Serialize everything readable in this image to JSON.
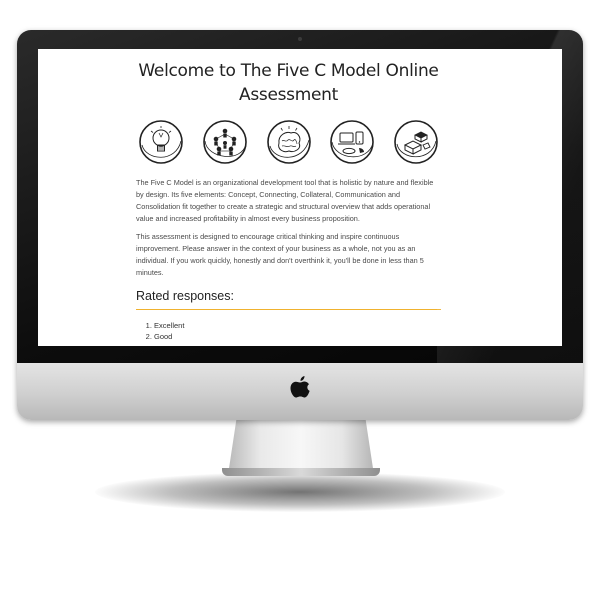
{
  "page": {
    "title": "Welcome to The Five C Model Online Assessment",
    "icons": [
      {
        "name": "lightbulb-icon",
        "concept": "Concept"
      },
      {
        "name": "connecting-people-icon",
        "concept": "Connecting"
      },
      {
        "name": "collateral-brain-icon",
        "concept": "Collateral"
      },
      {
        "name": "communication-devices-icon",
        "concept": "Communication"
      },
      {
        "name": "consolidation-blocks-icon",
        "concept": "Consolidation"
      }
    ],
    "intro_paragraph": "The Five C Model is an organizational development tool that is holistic by nature and flexible by design. Its five elements: Concept, Connecting, Collateral, Communication and Consolidation fit together to create a strategic and structural overview that adds operational value and increased profitability in almost every business proposition.",
    "second_paragraph": "This assessment is designed to encourage critical thinking and inspire continuous improvement. Please answer in the context of your business as a whole, not you as an individual. If you work quickly, honestly and don't overthink it, you'll be done in less than 5 minutes.",
    "rated_heading": "Rated responses:",
    "ratings": [
      "Excellent",
      "Good"
    ]
  },
  "device": {
    "logo": "apple-logo-icon",
    "bezel_color": "#111111",
    "chin_color": "#d4d4d4",
    "accent_color": "#f0b22e"
  }
}
